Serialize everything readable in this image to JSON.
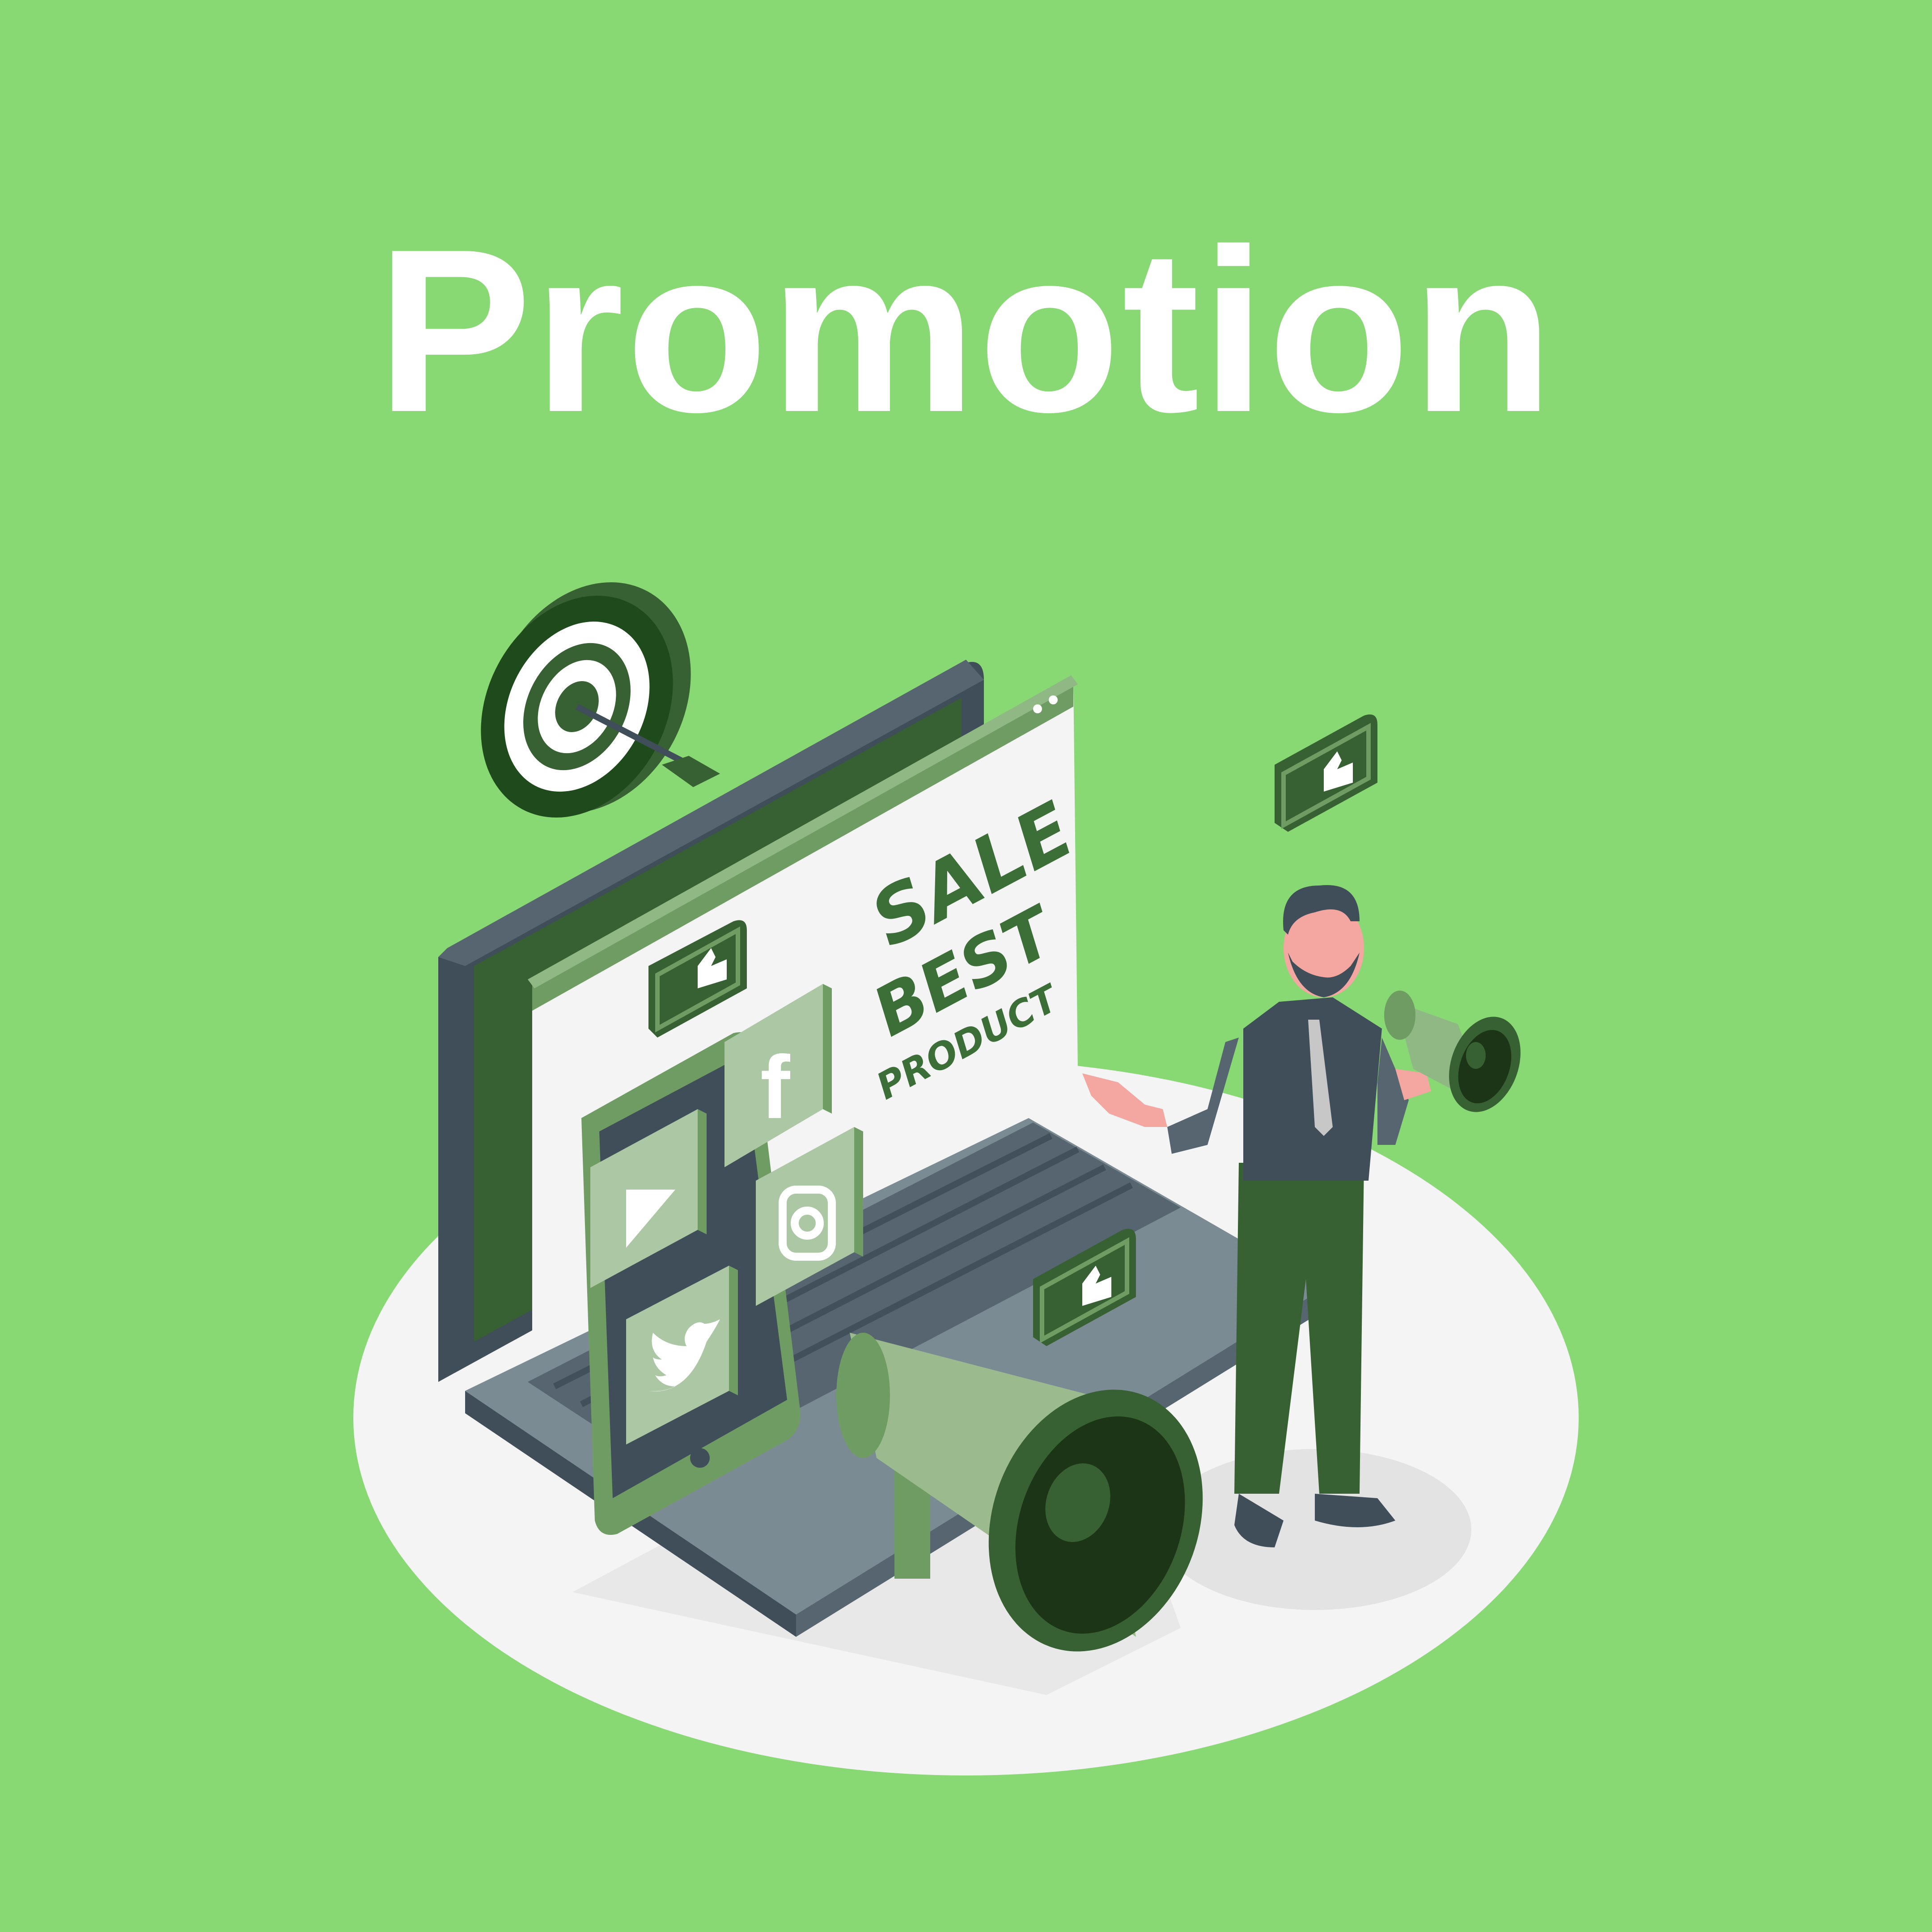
{
  "page": {
    "title": "Promotion"
  },
  "illustration": {
    "screen_banner": {
      "line1": "SALE",
      "line2": "BEST",
      "line3": "PRODUCT"
    },
    "social_icons": [
      "facebook-icon",
      "instagram-icon",
      "twitter-icon",
      "play-icon"
    ],
    "decorations": [
      "target-icon",
      "thumbs-up-icon",
      "megaphone-icon"
    ]
  },
  "colors": {
    "background": "#88d874",
    "title": "#ffffff",
    "dark_green": "#376132",
    "mid_green": "#6f9c63",
    "light_green": "#abc7a3",
    "slate": "#3f4e59",
    "floor": "#f4f4f4"
  }
}
